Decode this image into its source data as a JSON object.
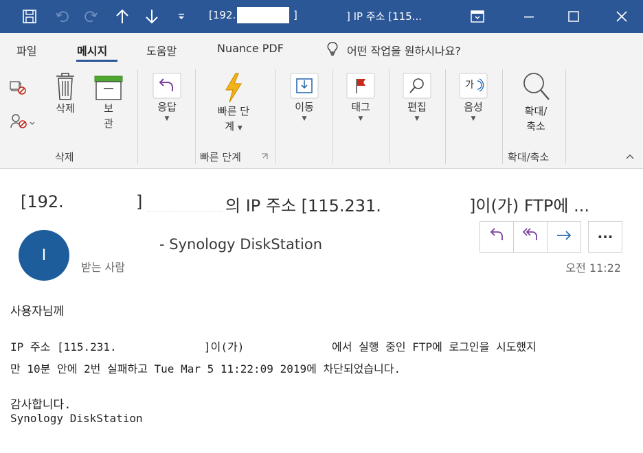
{
  "window": {
    "title_left": "[192.",
    "title_mid": "]",
    "title_right": "] IP 주소 [115..."
  },
  "ribbon_tabs": [
    "파일",
    "메시지",
    "도움말",
    "Nuance PDF"
  ],
  "tell_me": "어떤 작업을 원하시나요?",
  "ribbon": {
    "delete_label": "삭제",
    "archive_label_1": "보",
    "archive_label_2": "관",
    "respond_label": "응답",
    "quick_steps_label_1": "빠른 단",
    "quick_steps_label_2": "계",
    "move_label": "이동",
    "tags_label": "태그",
    "editing_label": "편집",
    "speech_label": "음성",
    "zoom_label_1": "확대/",
    "zoom_label_2": "축소",
    "group_delete": "삭제",
    "group_quick_steps": "빠른 단계",
    "group_zoom": "확대/축소",
    "speech_icon_text": "가"
  },
  "message": {
    "subject_part1": "[192.",
    "subject_part2": "]",
    "subject_part3": "의 IP 주소 [115.231.",
    "subject_part4": "]이(가) FTP에 ...",
    "avatar_initial": "I",
    "sender": "- Synology DiskStation",
    "to_label": "받는 사람",
    "time": "오전 11:22",
    "more_label": "···"
  },
  "body": {
    "greeting": "사용자님께",
    "line1_a": "IP 주소 [115.231.",
    "line1_b": "]이(가)",
    "line1_c": "에서 실행 중인 FTP에 로그인을 시도했지",
    "line2": "만 10분 안에 2번 실패하고 Tue Mar  5 11:22:09 2019에 차단되었습니다.",
    "thanks": "감사합니다.",
    "signature": "Synology DiskStation"
  },
  "colors": {
    "titlebar": "#2b5797",
    "ribbon_bg": "#f3f3f3",
    "avatar": "#1e5d9c",
    "action_icon": "#2b6cb0",
    "reply_icon": "#7a3fa0",
    "flag": "#c42b1c",
    "lightning": "#f2b21b"
  }
}
